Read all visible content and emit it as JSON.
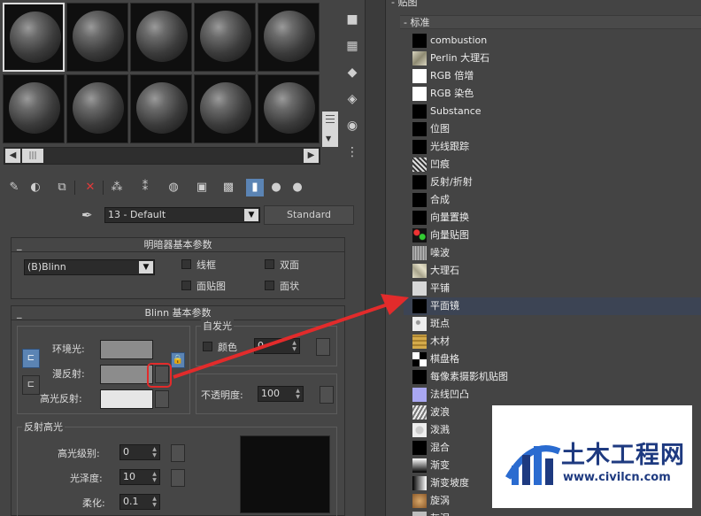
{
  "toolbar": {
    "material_name": "13 - Default",
    "material_type": "Standard"
  },
  "shader": {
    "title": "明暗器基本参数",
    "selected": "(B)Blinn",
    "wire": "线框",
    "twosided": "双面",
    "facemap": "面贴图",
    "faceted": "面状"
  },
  "blinn": {
    "title": "Blinn 基本参数",
    "self_illum": "自发光",
    "color": "颜色",
    "self_illum_value": "0",
    "ambient": "环境光:",
    "diffuse": "漫反射:",
    "specular": "高光反射:",
    "opacity": "不透明度:",
    "opacity_value": "100",
    "swatch_colors": {
      "ambient": "#8c8c8c",
      "diffuse": "#8c8c8c",
      "specular": "#e6e6e6"
    }
  },
  "highlight": {
    "title": "反射高光",
    "level": "高光级别:",
    "level_value": "0",
    "gloss": "光泽度:",
    "gloss_value": "10",
    "soften": "柔化:",
    "soften_value": "0.1"
  },
  "maps": {
    "root": "贴图",
    "group": "标准",
    "items": [
      {
        "label": "combustion",
        "icon": "black"
      },
      {
        "label": "Perlin 大理石",
        "icon": "marble"
      },
      {
        "label": "RGB 倍增",
        "icon": "white"
      },
      {
        "label": "RGB 染色",
        "icon": "white"
      },
      {
        "label": "Substance",
        "icon": "black"
      },
      {
        "label": "位图",
        "icon": "black"
      },
      {
        "label": "光线跟踪",
        "icon": "black"
      },
      {
        "label": "凹痕",
        "icon": "dent"
      },
      {
        "label": "反射/折射",
        "icon": "black"
      },
      {
        "label": "合成",
        "icon": "black"
      },
      {
        "label": "向量置换",
        "icon": "black"
      },
      {
        "label": "向量贴图",
        "icon": "vector"
      },
      {
        "label": "噪波",
        "icon": "noise"
      },
      {
        "label": "大理石",
        "icon": "marble2"
      },
      {
        "label": "平铺",
        "icon": "tile"
      },
      {
        "label": "平面镜",
        "icon": "black"
      },
      {
        "label": "斑点",
        "icon": "speckle"
      },
      {
        "label": "木材",
        "icon": "wood"
      },
      {
        "label": "棋盘格",
        "icon": "checker"
      },
      {
        "label": "每像素摄影机贴图",
        "icon": "black"
      },
      {
        "label": "法线凹凸",
        "icon": "normal"
      },
      {
        "label": "波浪",
        "icon": "wave"
      },
      {
        "label": "泼溅",
        "icon": "splat"
      },
      {
        "label": "混合",
        "icon": "black"
      },
      {
        "label": "渐变",
        "icon": "gradient"
      },
      {
        "label": "渐变坡度",
        "icon": "ramp"
      },
      {
        "label": "旋涡",
        "icon": "swirl"
      },
      {
        "label": "灰泥",
        "icon": "stucco"
      }
    ],
    "highlighted_index": 15
  },
  "watermark": {
    "title": "土木工程网",
    "url": "www.civilcn.com"
  },
  "colors": {
    "panel": "#444444",
    "accent": "#5b84b4",
    "annotation": "#e22b2b",
    "brand": "#1e3a80"
  }
}
